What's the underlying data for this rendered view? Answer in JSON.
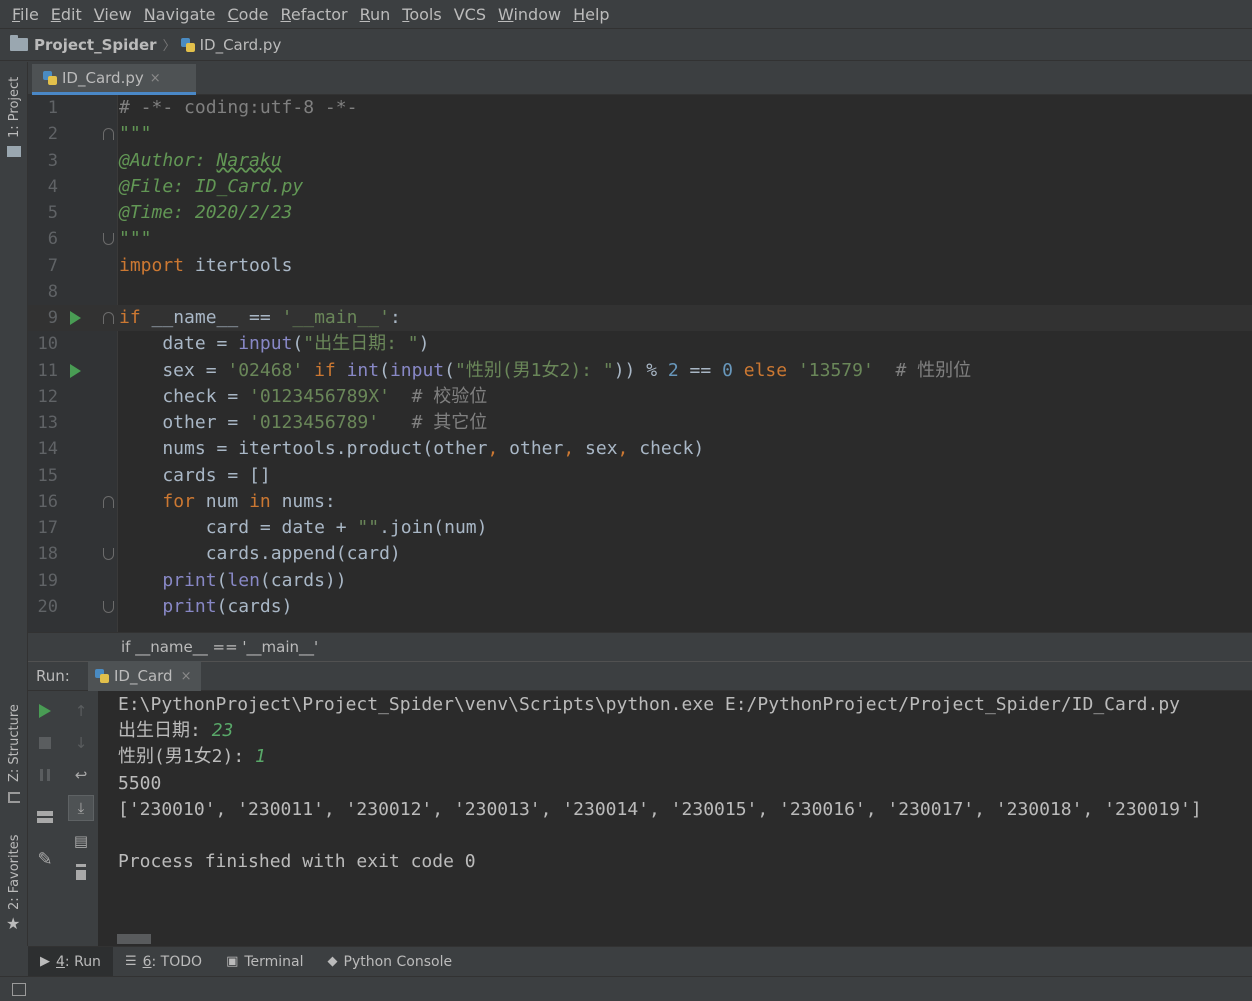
{
  "menu": {
    "items": [
      {
        "mn": "F",
        "rest": "ile"
      },
      {
        "mn": "E",
        "rest": "dit"
      },
      {
        "mn": "V",
        "rest": "iew"
      },
      {
        "mn": "N",
        "rest": "avigate"
      },
      {
        "mn": "C",
        "rest": "ode"
      },
      {
        "mn": "R",
        "rest": "efactor"
      },
      {
        "mn": "R",
        "rest": "un"
      },
      {
        "mn": "T",
        "rest": "ools"
      },
      {
        "mn": "",
        "rest": "VCS"
      },
      {
        "mn": "W",
        "rest": "indow"
      },
      {
        "mn": "H",
        "rest": "elp"
      }
    ]
  },
  "navbar": {
    "project": "Project_Spider",
    "file": "ID_Card.py"
  },
  "left_stripe": {
    "project": "1: Project",
    "structure": "Z: Structure",
    "favorites": "2: Favorites"
  },
  "editor_tab": {
    "label": "ID_Card.py",
    "close": "×"
  },
  "editor": {
    "lines": [
      {
        "n": "1",
        "fold": "",
        "run": false,
        "current": false,
        "tokens": [
          {
            "t": "# -*- coding:utf-8 -*-",
            "c": "cmt"
          }
        ]
      },
      {
        "n": "2",
        "fold": "up",
        "run": false,
        "current": false,
        "tokens": [
          {
            "t": "\"\"\"",
            "c": "doc"
          }
        ]
      },
      {
        "n": "3",
        "fold": "",
        "run": false,
        "current": false,
        "tokens": [
          {
            "t": "@Author: ",
            "c": "doc"
          },
          {
            "t": "Naraku",
            "c": "doc wavy"
          }
        ]
      },
      {
        "n": "4",
        "fold": "",
        "run": false,
        "current": false,
        "tokens": [
          {
            "t": "@File: ID_Card.py",
            "c": "doc"
          }
        ]
      },
      {
        "n": "5",
        "fold": "",
        "run": false,
        "current": false,
        "tokens": [
          {
            "t": "@Time: 2020/2/23",
            "c": "doc"
          }
        ]
      },
      {
        "n": "6",
        "fold": "down",
        "run": false,
        "current": false,
        "tokens": [
          {
            "t": "\"\"\"",
            "c": "doc"
          }
        ]
      },
      {
        "n": "7",
        "fold": "",
        "run": false,
        "current": false,
        "tokens": [
          {
            "t": "import",
            "c": "kw"
          },
          {
            "t": " itertools",
            "c": ""
          }
        ]
      },
      {
        "n": "8",
        "fold": "",
        "run": false,
        "current": false,
        "tokens": []
      },
      {
        "n": "9",
        "fold": "up",
        "run": true,
        "current": true,
        "tokens": [
          {
            "t": "if",
            "c": "kw"
          },
          {
            "t": " __name__ == ",
            "c": ""
          },
          {
            "t": "'__main__'",
            "c": "str"
          },
          {
            "t": ":",
            "c": ""
          }
        ]
      },
      {
        "n": "10",
        "fold": "",
        "run": false,
        "current": false,
        "tokens": [
          {
            "t": "    date = ",
            "c": ""
          },
          {
            "t": "input",
            "c": "bi"
          },
          {
            "t": "(",
            "c": ""
          },
          {
            "t": "\"出生日期: \"",
            "c": "str"
          },
          {
            "t": ")",
            "c": ""
          }
        ]
      },
      {
        "n": "11",
        "fold": "",
        "run": true,
        "current": false,
        "tokens": [
          {
            "t": "    sex = ",
            "c": ""
          },
          {
            "t": "'02468'",
            "c": "str"
          },
          {
            "t": " if ",
            "c": "kw"
          },
          {
            "t": "int",
            "c": "bi"
          },
          {
            "t": "(",
            "c": ""
          },
          {
            "t": "input",
            "c": "bi"
          },
          {
            "t": "(",
            "c": ""
          },
          {
            "t": "\"性别(男1女2): \"",
            "c": "str"
          },
          {
            "t": ")) % ",
            "c": ""
          },
          {
            "t": "2",
            "c": "num"
          },
          {
            "t": " == ",
            "c": ""
          },
          {
            "t": "0",
            "c": "num"
          },
          {
            "t": " else ",
            "c": "kw"
          },
          {
            "t": "'13579'",
            "c": "str"
          },
          {
            "t": "  # 性别位",
            "c": "cmt"
          }
        ]
      },
      {
        "n": "12",
        "fold": "",
        "run": false,
        "current": false,
        "tokens": [
          {
            "t": "    check = ",
            "c": ""
          },
          {
            "t": "'0123456789X'",
            "c": "str"
          },
          {
            "t": "  # 校验位",
            "c": "cmt"
          }
        ]
      },
      {
        "n": "13",
        "fold": "",
        "run": false,
        "current": false,
        "tokens": [
          {
            "t": "    other = ",
            "c": ""
          },
          {
            "t": "'0123456789'",
            "c": "str"
          },
          {
            "t": "   # 其它位",
            "c": "cmt"
          }
        ]
      },
      {
        "n": "14",
        "fold": "",
        "run": false,
        "current": false,
        "tokens": [
          {
            "t": "    nums = itertools.product(other",
            "c": ""
          },
          {
            "t": ",",
            "c": "kw"
          },
          {
            "t": " other",
            "c": ""
          },
          {
            "t": ",",
            "c": "kw"
          },
          {
            "t": " sex",
            "c": ""
          },
          {
            "t": ",",
            "c": "kw"
          },
          {
            "t": " check)",
            "c": ""
          }
        ]
      },
      {
        "n": "15",
        "fold": "",
        "run": false,
        "current": false,
        "tokens": [
          {
            "t": "    cards = []",
            "c": ""
          }
        ]
      },
      {
        "n": "16",
        "fold": "up",
        "run": false,
        "current": false,
        "tokens": [
          {
            "t": "    ",
            "c": ""
          },
          {
            "t": "for",
            "c": "kw"
          },
          {
            "t": " num ",
            "c": ""
          },
          {
            "t": "in",
            "c": "kw"
          },
          {
            "t": " nums:",
            "c": ""
          }
        ]
      },
      {
        "n": "17",
        "fold": "",
        "run": false,
        "current": false,
        "tokens": [
          {
            "t": "        card = date + ",
            "c": ""
          },
          {
            "t": "\"\"",
            "c": "str"
          },
          {
            "t": ".join(num)",
            "c": ""
          }
        ]
      },
      {
        "n": "18",
        "fold": "down",
        "run": false,
        "current": false,
        "tokens": [
          {
            "t": "        cards.append(card)",
            "c": ""
          }
        ]
      },
      {
        "n": "19",
        "fold": "",
        "run": false,
        "current": false,
        "tokens": [
          {
            "t": "    ",
            "c": ""
          },
          {
            "t": "print",
            "c": "bi"
          },
          {
            "t": "(",
            "c": ""
          },
          {
            "t": "len",
            "c": "bi"
          },
          {
            "t": "(cards))",
            "c": ""
          }
        ]
      },
      {
        "n": "20",
        "fold": "down",
        "run": false,
        "current": false,
        "tokens": [
          {
            "t": "    ",
            "c": ""
          },
          {
            "t": "print",
            "c": "bi"
          },
          {
            "t": "(cards)",
            "c": ""
          }
        ]
      }
    ]
  },
  "editor_breadcrumb": "if __name__ == '__main__'",
  "run_panel": {
    "label": "Run:",
    "tab": "ID_Card",
    "close": "×"
  },
  "console": {
    "lines": [
      {
        "text": "E:\\PythonProject\\Project_Spider\\venv\\Scripts\\python.exe E:/PythonProject/Project_Spider/ID_Card.py",
        "input": ""
      },
      {
        "text": "出生日期: ",
        "input": "23"
      },
      {
        "text": "性别(男1女2): ",
        "input": "1"
      },
      {
        "text": "5500",
        "input": ""
      },
      {
        "text": "['230010', '230011', '230012', '230013', '230014', '230015', '230016', '230017', '230018', '230019']",
        "input": ""
      },
      {
        "text": "",
        "input": ""
      },
      {
        "text": "Process finished with exit code 0",
        "input": ""
      }
    ]
  },
  "bottom_tabs": [
    {
      "mn": "4",
      "rest": ": Run",
      "icon": "▶",
      "active": true
    },
    {
      "mn": "6",
      "rest": ": TODO",
      "icon": "☰",
      "active": false
    },
    {
      "mn": "",
      "rest": "Terminal",
      "icon": "▣",
      "active": false
    },
    {
      "mn": "",
      "rest": "Python Console",
      "icon": "◆",
      "active": false
    }
  ],
  "icons": [
    "folder-icon",
    "python-file-icon",
    "run-icon",
    "stop-icon",
    "pause-icon",
    "up-arrow-icon",
    "down-arrow-icon",
    "soft-wrap-icon",
    "scroll-to-end-icon",
    "print-icon",
    "trash-icon",
    "layout-icon",
    "pin-icon",
    "star-icon"
  ],
  "colors": {
    "bg": "#2b2b2b",
    "keyword": "#cc7832",
    "string": "#6a8759",
    "number": "#6897bb",
    "comment": "#808080",
    "docstring": "#629755",
    "builtin": "#8888c6",
    "run_green": "#499c54",
    "input_green": "#59a869"
  }
}
